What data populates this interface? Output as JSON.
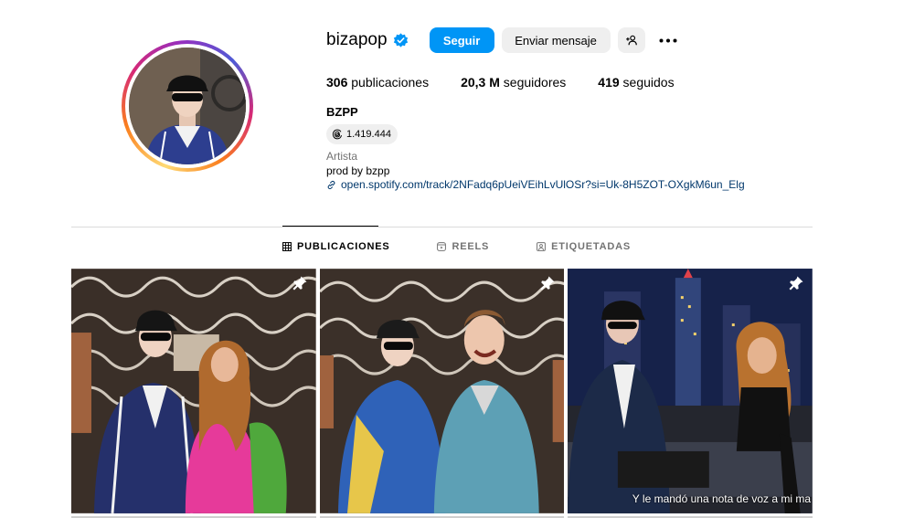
{
  "profile": {
    "username": "bizapop",
    "follow_label": "Seguir",
    "message_label": "Enviar mensaje",
    "suggest_icon": "person-add-icon",
    "more_icon": "more-horizontal-icon"
  },
  "stats": {
    "posts_value": "306",
    "posts_label": "publicaciones",
    "followers_value": "20,3 M",
    "followers_label": "seguidores",
    "following_value": "419",
    "following_label": "seguidos"
  },
  "bio": {
    "name": "BZPP",
    "threads_count": "1.419.444",
    "category": "Artista",
    "text": "prod by bzpp",
    "link": "open.spotify.com/track/2NFadq6pUeiVEihLvUlOSr?si=Uk-8H5ZOT-OXgkM6un_Elg"
  },
  "tabs": [
    {
      "label": "PUBLICACIONES",
      "icon": "grid-icon",
      "active": true
    },
    {
      "label": "REELS",
      "icon": "reels-icon",
      "active": false
    },
    {
      "label": "ETIQUETADAS",
      "icon": "tagged-icon",
      "active": false
    }
  ],
  "posts": [
    {
      "pinned": true,
      "caption": ""
    },
    {
      "pinned": true,
      "caption": ""
    },
    {
      "pinned": true,
      "caption": "Y le mandó una nota de voz a mi ma"
    }
  ],
  "colors": {
    "accent": "#0095f6",
    "button_gray": "#efefef",
    "link": "#00376b",
    "secondary_text": "#737373",
    "divider": "#dbdbdb"
  }
}
